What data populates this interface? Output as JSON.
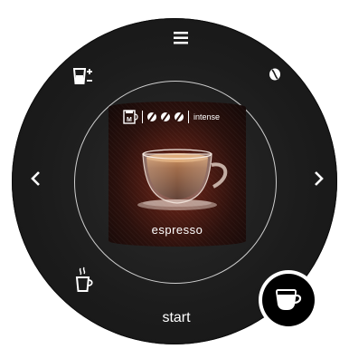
{
  "panel": {
    "menu_icon": "menu-icon",
    "bean_icon": "coffee-bean-icon",
    "cup_size_icon": "cup-size-adjust-icon",
    "hot_cup_icon": "hot-cup-icon",
    "confirm_icon": "coffee-cup-icon",
    "nav_left": "‹",
    "nav_right": "›",
    "start_label": "start"
  },
  "display": {
    "mug_badge": "M",
    "strength_label": "intense",
    "strength_level": 3,
    "strength_max": 3,
    "beverage_name": "espresso"
  },
  "colors": {
    "dial_bg": "#1c1c1c",
    "screen_glow": "#7a2b1c",
    "ring": "#cfcfcf",
    "accent": "#ffffff"
  }
}
